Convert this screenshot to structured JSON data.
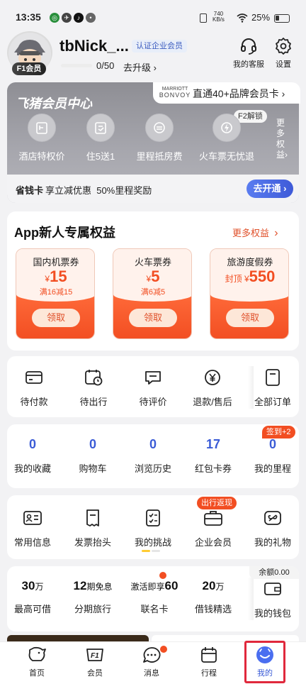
{
  "status_bar": {
    "time": "13:35",
    "net_speed": "740",
    "net_unit": "KB/s",
    "battery": "25%"
  },
  "profile": {
    "username": "tbNick_...",
    "cert_badge": "认证企业会员",
    "level_badge": "F1会员",
    "progress_text": "0/50",
    "upgrade_label": "去升级",
    "service_label": "我的客服",
    "settings_label": "设置"
  },
  "vip": {
    "title": "飞猪会员中心",
    "brand_logo_lines": [
      "MARRIOTT",
      "BONVOY"
    ],
    "brand_promo": "直通40+品牌会员卡",
    "lock_tag": "F2解锁",
    "items": [
      {
        "label": "酒店特权价",
        "icon": "hotel-price-icon"
      },
      {
        "label": "住5送1",
        "icon": "stay-gift-icon"
      },
      {
        "label": "里程抵房费",
        "icon": "mileage-room-icon"
      },
      {
        "label": "火车票无忧退",
        "icon": "train-refund-icon"
      }
    ],
    "more_label": "更多权益",
    "save_title": "省钱卡",
    "save_desc": "享立减优惠  50%里程奖励",
    "open_label": "去开通"
  },
  "new_user": {
    "title": "App新人专属权益",
    "more_label": "更多权益",
    "coupons": [
      {
        "name": "国内机票券",
        "prefix": "¥",
        "amount": "15",
        "condition": "满16减15",
        "button": "领取"
      },
      {
        "name": "火车票券",
        "prefix": "¥",
        "amount": "5",
        "condition": "满6减5",
        "button": "领取"
      },
      {
        "name": "旅游度假券",
        "prefix": "封顶 ¥",
        "amount": "550",
        "condition": "",
        "button": "领取"
      }
    ]
  },
  "orders": [
    {
      "label": "待付款",
      "icon": "wallet-card-icon"
    },
    {
      "label": "待出行",
      "icon": "calendar-clock-icon"
    },
    {
      "label": "待评价",
      "icon": "comment-icon"
    },
    {
      "label": "退款/售后",
      "icon": "yuan-refund-icon"
    },
    {
      "label": "全部订单",
      "icon": "order-list-icon"
    }
  ],
  "stats": {
    "sign_tag": "签到+2",
    "items": [
      {
        "value": "0",
        "label": "我的收藏"
      },
      {
        "value": "0",
        "label": "购物车"
      },
      {
        "value": "0",
        "label": "浏览历史"
      },
      {
        "value": "17",
        "label": "红包卡券"
      },
      {
        "value": "0",
        "label": "我的里程"
      }
    ]
  },
  "tools": {
    "promo_tag": "出行返现",
    "items": [
      {
        "label": "常用信息",
        "icon": "id-card-icon"
      },
      {
        "label": "发票抬头",
        "icon": "invoice-icon"
      },
      {
        "label": "我的挑战",
        "icon": "checklist-icon"
      },
      {
        "label": "企业会员",
        "icon": "enterprise-icon"
      },
      {
        "label": "我的礼物",
        "icon": "gift-icon"
      }
    ]
  },
  "finance": {
    "balance_tag": "余额0.00",
    "items": [
      {
        "big": "30",
        "unit": "万",
        "label": "最高可借"
      },
      {
        "big": "12",
        "unit": "期免息",
        "label": "分期旅行",
        "bigpre": ""
      },
      {
        "big": "60",
        "unit": "",
        "pre": "激活即享",
        "label": "联名卡"
      },
      {
        "big": "20",
        "unit": "万",
        "label": "借钱精选"
      }
    ],
    "wallet_label": "我的钱包"
  },
  "tabbar": [
    {
      "label": "首页",
      "icon": "pig-home-icon"
    },
    {
      "label": "会员",
      "icon": "f1-member-icon"
    },
    {
      "label": "消息",
      "icon": "message-bubble-icon"
    },
    {
      "label": "行程",
      "icon": "itinerary-calendar-icon"
    },
    {
      "label": "我的",
      "icon": "my-profile-icon"
    }
  ],
  "colors": {
    "accent": "#f24e22",
    "blue": "#3a5bd6",
    "vip_gray": "#9a9aa0"
  }
}
